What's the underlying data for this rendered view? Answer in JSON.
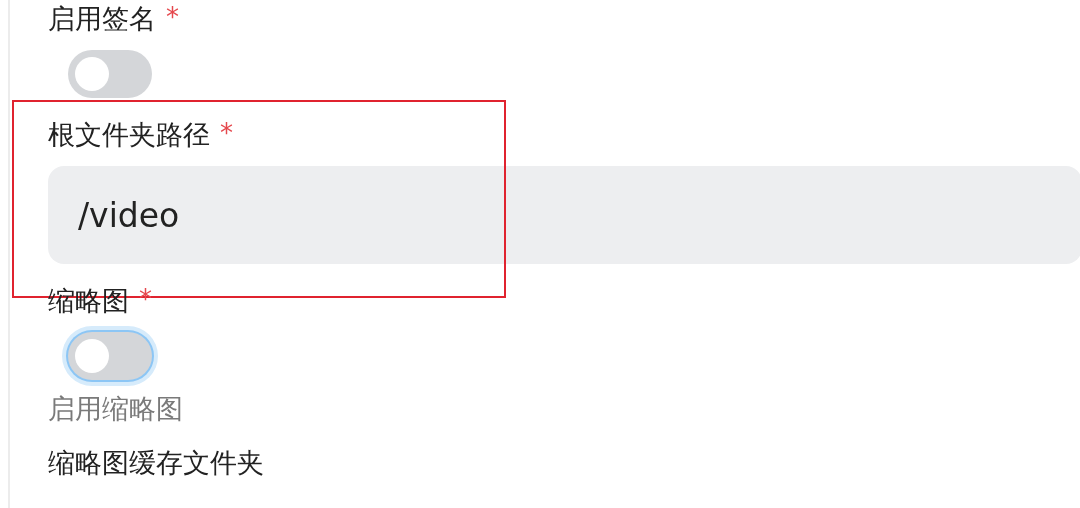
{
  "fields": [
    {
      "kind": "toggle",
      "label": "启用签名",
      "required_mark": "*",
      "on": false,
      "focused": false
    },
    {
      "kind": "text",
      "label": "根文件夹路径",
      "required_mark": "*",
      "value": "/video",
      "highlighted": true
    },
    {
      "kind": "toggle",
      "label": "缩略图",
      "required_mark": "*",
      "on": false,
      "focused": true,
      "help": "启用缩略图"
    },
    {
      "kind": "heading",
      "label": "缩略图缓存文件夹"
    }
  ]
}
